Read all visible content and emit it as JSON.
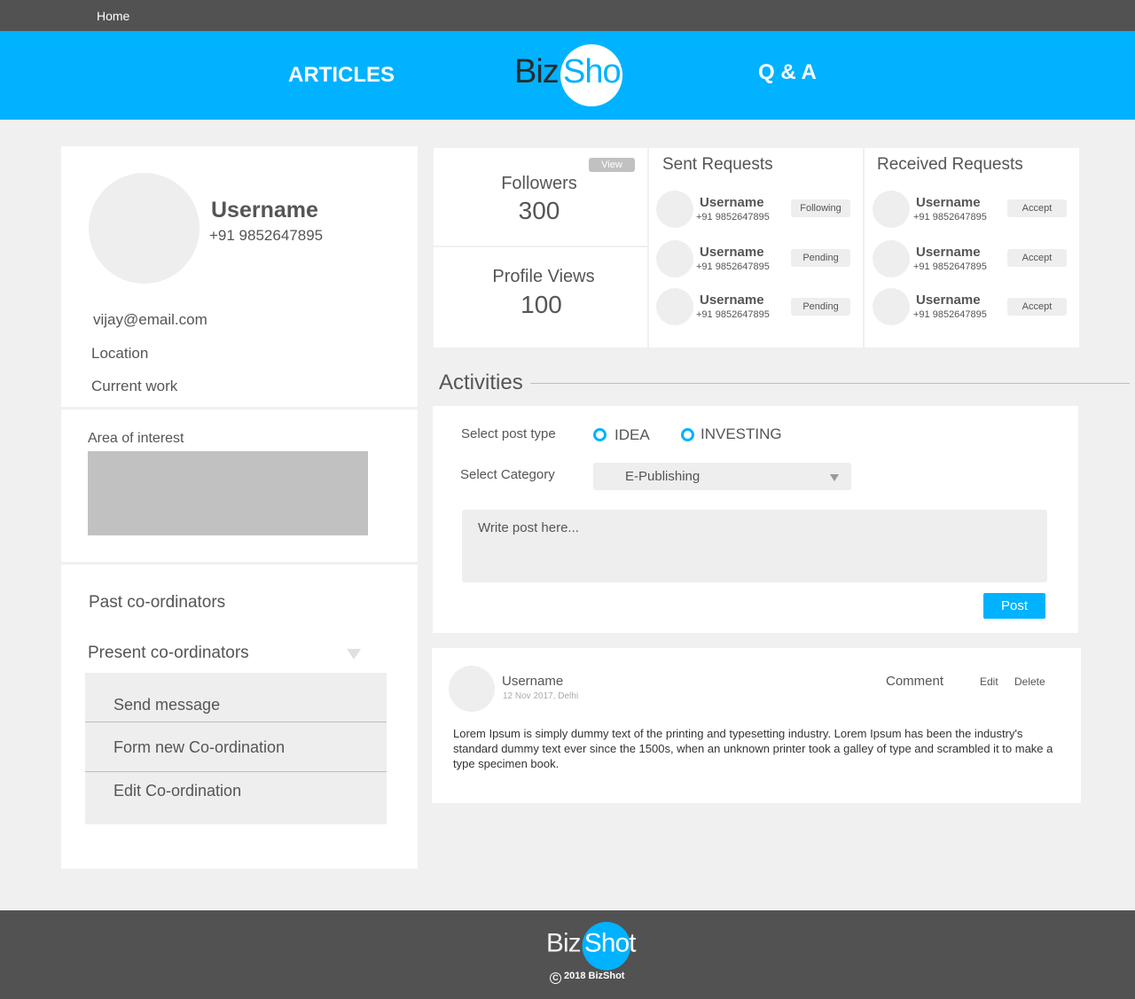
{
  "topbar": {
    "home": "Home"
  },
  "header": {
    "nav_articles": "ARTICLES",
    "nav_qa": "Q & A"
  },
  "logo": {
    "biz": "Biz",
    "shot": "Shot"
  },
  "profile": {
    "name": "Username",
    "phone": "+91 9852647895",
    "email": "vijay@email.com",
    "location": "Location",
    "current_work": "Current work",
    "area_of_interest_label": "Area of interest",
    "past_coordinators": "Past co-ordinators",
    "present_coordinators": "Present co-ordinators",
    "menu": [
      "Send message",
      "Form new Co-ordination",
      "Edit Co-ordination"
    ]
  },
  "stats": {
    "view_label": "View",
    "followers_label": "Followers",
    "followers_value": "300",
    "views_label": "Profile Views",
    "views_value": "100"
  },
  "sent_requests": {
    "title": "Sent Requests",
    "items": [
      {
        "name": "Username",
        "phone": "+91 9852647895",
        "status": "Following"
      },
      {
        "name": "Username",
        "phone": "+91 9852647895",
        "status": "Pending"
      },
      {
        "name": "Username",
        "phone": "+91 9852647895",
        "status": "Pending"
      }
    ]
  },
  "received_requests": {
    "title": "Received Requests",
    "items": [
      {
        "name": "Username",
        "phone": "+91 9852647895",
        "action": "Accept"
      },
      {
        "name": "Username",
        "phone": "+91 9852647895",
        "action": "Accept"
      },
      {
        "name": "Username",
        "phone": "+91 9852647895",
        "action": "Accept"
      }
    ]
  },
  "activities": {
    "title": "Activities",
    "post_type_label": "Select post type",
    "post_types": [
      "IDEA",
      "INVESTING"
    ],
    "category_label": "Select Category",
    "category_value": "E-Publishing",
    "textarea_placeholder": "Write post here...",
    "post_button": "Post"
  },
  "feed": {
    "username": "Username",
    "meta": "12 Nov 2017, Delhi",
    "comment": "Comment",
    "edit": "Edit",
    "delete": "Delete",
    "text": "Lorem Ipsum is simply dummy text of the printing and typesetting industry. Lorem Ipsum has been the industry's standard dummy text ever since the 1500s, when an unknown printer took a galley of type and scrambled it to make a type specimen book."
  },
  "footer": {
    "copyright": "2018 BizShot",
    "copyright_symbol": "C"
  },
  "colors": {
    "accent": "#00b2ff",
    "dark_bar": "#525252",
    "page_bg": "#f0f0f0"
  }
}
